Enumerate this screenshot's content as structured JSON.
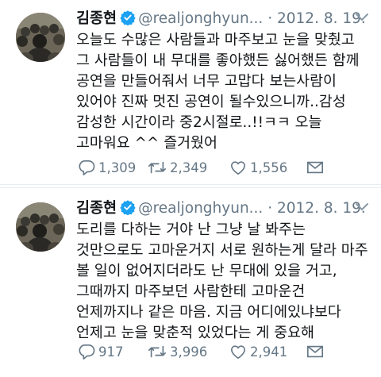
{
  "tweets": [
    {
      "name": "김종현",
      "handle": "@realjonghyun...",
      "separator": "·",
      "date": "2012. 8. 19.",
      "lines": [
        "오늘도 수많은 사람들과 마주보고 눈을 맞췄고",
        "그 사람들이 내 무대를 좋아했든 싫어했든 함께",
        "공연을 만들어줘서 너무 고맙다 보는사람이",
        "있어야 진짜 멋진 공연이 될수있으니까..감성",
        "감성한 시간이라 중2시절로..!!ㅋㅋ 오늘",
        "고마워요 ^^ 즐거웠어"
      ],
      "replies": "1,309",
      "retweets": "2,349",
      "likes": "1,556"
    },
    {
      "name": "김종현",
      "handle": "@realjonghyun...",
      "separator": "·",
      "date": "2012. 8. 19.",
      "lines": [
        "도리를 다하는 거야 난 그냥 날 봐주는",
        "것만으로도 고마운거지 서로 원하는게 달라 마주",
        "볼 일이 없어지더라도 난 무대에 있을 거고,",
        "그때까지 마주보던 사람한테 고마운건",
        "언제까지나 같은 마음. 지금 어디에있냐보다",
        "언제고 눈을 맞춘적 있었다는 게 중요해"
      ],
      "replies": "917",
      "retweets": "3,996",
      "likes": "2,941"
    }
  ],
  "colors": {
    "text": "#14171a",
    "muted": "#657786",
    "verified": "#1da1f2",
    "divider": "#e6ecf0"
  },
  "icons": [
    "avatar-image",
    "verified-badge-icon",
    "chevron-down-icon",
    "reply-icon",
    "retweet-icon",
    "like-icon",
    "share-dm-icon"
  ]
}
